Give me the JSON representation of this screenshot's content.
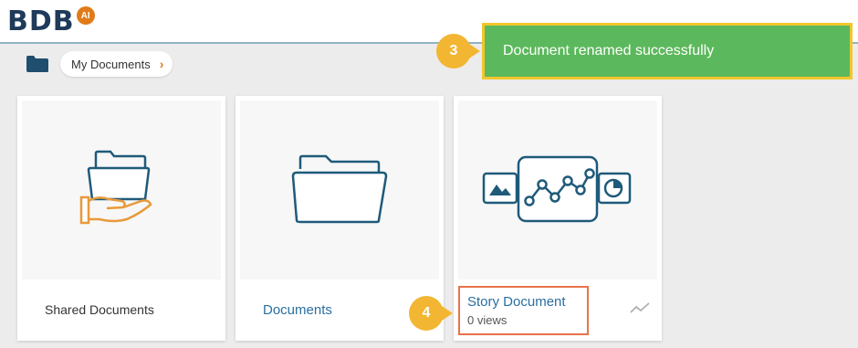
{
  "app": {
    "logo_text": "BDB",
    "logo_badge": "AI"
  },
  "breadcrumb": {
    "label": "My Documents",
    "chevron": "›",
    "icon": "folder-icon"
  },
  "toast": {
    "message": "Document renamed successfully",
    "color": "#5cb85c",
    "highlight": "#f2c62c"
  },
  "callouts": {
    "step3": "3",
    "step4": "4",
    "color": "#f2b632"
  },
  "cards": [
    {
      "title": "Shared Documents",
      "icon": "shared-folder-hand-icon"
    },
    {
      "title": "Documents",
      "icon": "folder-icon"
    },
    {
      "title": "Story Document",
      "subtitle": "0 views",
      "icon": "story-chart-icon",
      "action_icon": "trend-icon"
    }
  ]
}
